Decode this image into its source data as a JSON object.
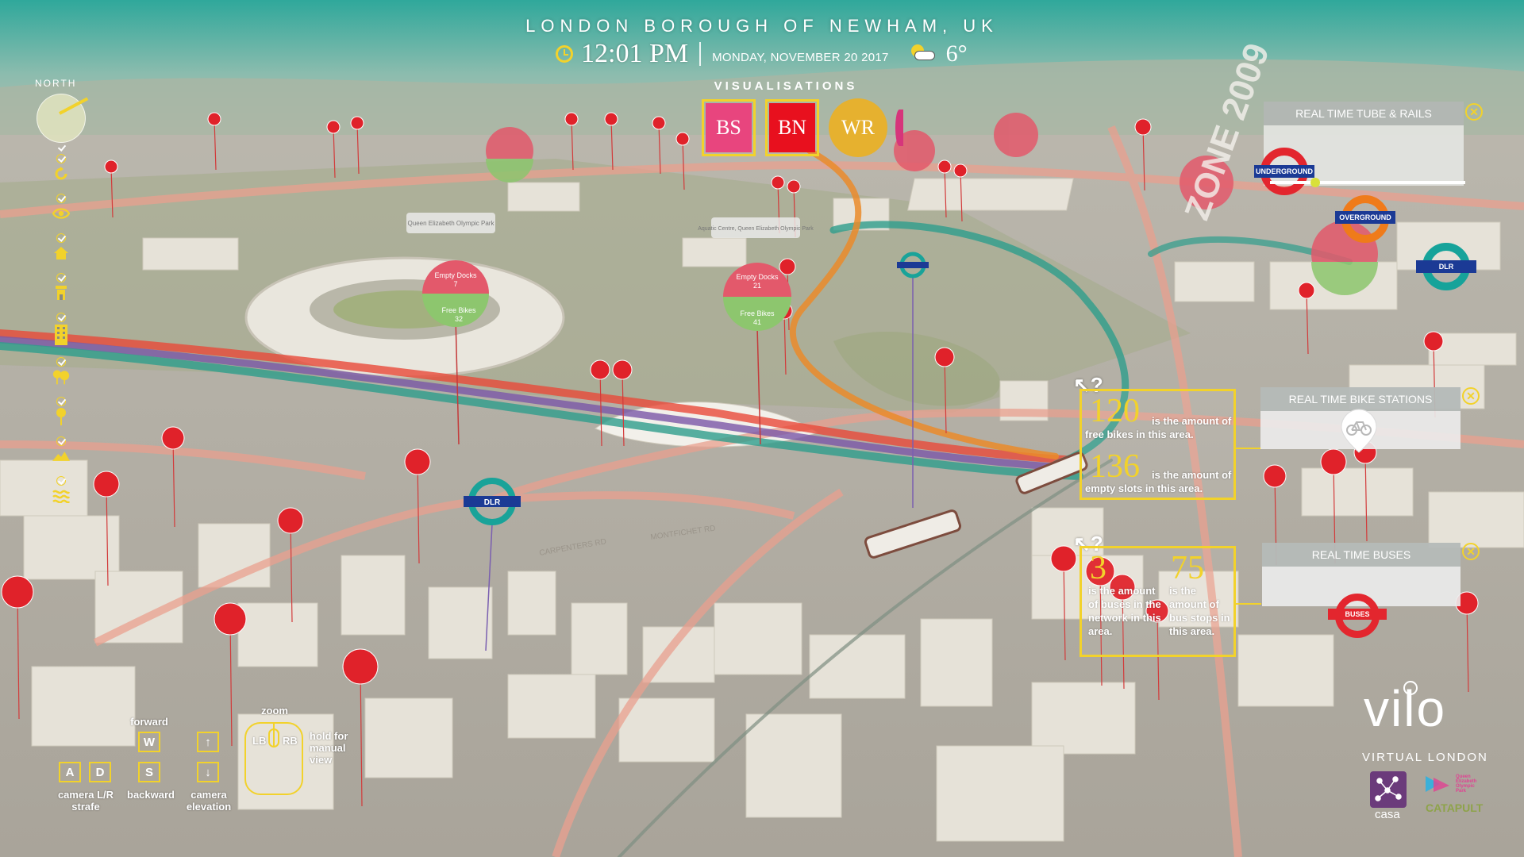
{
  "header": {
    "location": "LONDON BOROUGH OF NEWHAM, UK",
    "time": "12:01 PM",
    "date": "MONDAY, NOVEMBER 20 2017",
    "temperature": "6°",
    "weather_icon": "partly-cloudy-icon"
  },
  "visualisations": {
    "label": "VISUALISATIONS",
    "buttons": [
      {
        "label": "BS",
        "color": "#e8457e"
      },
      {
        "label": "BN",
        "color": "#e8101e"
      },
      {
        "label": "WR",
        "color": "#e6b12f"
      }
    ]
  },
  "toolbar": {
    "north_label": "NORTH",
    "tools": [
      "refresh-icon",
      "eye-icon",
      "home-icon",
      "building-icon",
      "tower-block-icon",
      "trees-icon",
      "pin-icon",
      "mountain-icon",
      "water-icon"
    ]
  },
  "bike_info": {
    "free_bikes": "120",
    "free_bikes_text": "is the amount of free bikes in this area.",
    "empty_slots": "136",
    "empty_slots_text": "is the amount of empty slots in this area."
  },
  "bus_info": {
    "buses": "3",
    "buses_text": "is the amount of buses in the network in this area.",
    "stops": "75",
    "stops_text": "is the amount of bus stops in this area."
  },
  "panels": {
    "tube": {
      "title": "REAL TIME TUBE & RAILS",
      "roundels": [
        {
          "label": "UNDERGROUND",
          "color": "#e3262e",
          "bar": "#1b3a95"
        },
        {
          "label": "OVERGROUND",
          "color": "#ef7b1a",
          "bar": "#1b3a95"
        },
        {
          "label": "DLR",
          "color": "#16a39a",
          "bar": "#1b3a95"
        }
      ],
      "slider_value": 0.22
    },
    "bikes": {
      "title": "REAL TIME BIKE STATIONS",
      "icon": "bike-pin-icon"
    },
    "buses": {
      "title": "REAL TIME BUSES",
      "roundel_label": "BUSES"
    }
  },
  "map_labels": {
    "dock1_empty": "Empty Docks",
    "dock1_empty_val": "7",
    "dock1_free": "Free Bikes",
    "dock1_free_val": "32",
    "dock2_empty": "Empty Docks",
    "dock2_empty_val": "21",
    "dock2_free": "Free Bikes",
    "dock2_free_val": "41",
    "label_a": "Queen Elizabeth Olympic Park",
    "label_b": "Aquatic Centre, Queen Elizabeth Olympic Park",
    "street1": "CARPENTERS RD",
    "street2": "MONTFICHET RD",
    "dlr": "DLR",
    "zone": "ZONE 2009"
  },
  "controls": {
    "forward_label": "forward",
    "backward_label": "backward",
    "strafe_label": "camera L/R strafe",
    "elevation_label": "camera elevation",
    "zoom_label": "zoom",
    "manual_label": "hold for manual view",
    "keys": {
      "w": "W",
      "a": "A",
      "s": "S",
      "d": "D",
      "up": "↑",
      "down": "↓",
      "lb": "LB",
      "rb": "RB"
    }
  },
  "branding": {
    "logo": "vilo",
    "subtitle": "VIRTUAL LONDON",
    "partner1": "casa",
    "partner2": "CATAPULT",
    "partner3": "Queen Elizabeth Olympic Park"
  }
}
